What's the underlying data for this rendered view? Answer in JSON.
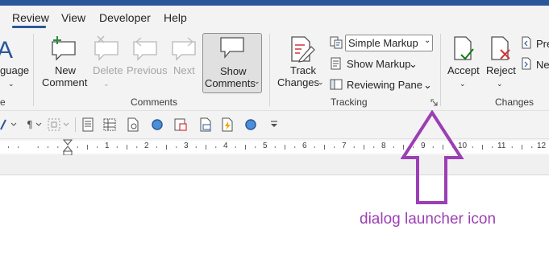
{
  "tabs": {
    "review": "Review",
    "view": "View",
    "developer": "Developer",
    "help": "Help"
  },
  "ribbon": {
    "language": {
      "label_partial": "guage"
    },
    "comments": {
      "group_label": "Comments",
      "new_comment_line1": "New",
      "new_comment_line2": "Comment",
      "delete": "Delete",
      "previous": "Previous",
      "next": "Next",
      "show_comments_line1": "Show",
      "show_comments_line2": "Comments"
    },
    "tracking": {
      "group_label": "Tracking",
      "track_changes_line1": "Track",
      "track_changes_line2": "Changes",
      "markup_select_value": "Simple Markup",
      "show_markup": "Show Markup",
      "reviewing_pane": "Reviewing Pane"
    },
    "changes": {
      "group_label": "Changes",
      "accept": "Accept",
      "reject": "Reject",
      "previous_partial": "Pre",
      "next_partial": "Ne"
    },
    "left_partial_label": "e"
  },
  "ruler": {
    "numbers": [
      "1",
      "2",
      "3",
      "4",
      "5",
      "6",
      "7",
      "8",
      "9",
      "10",
      "11",
      "12"
    ]
  },
  "annotation": {
    "label": "dialog launcher icon"
  },
  "colors": {
    "accent": "#2b579a",
    "annotation": "#9b3fb5",
    "reject_red": "#d13438",
    "accept_green": "#107c10"
  }
}
